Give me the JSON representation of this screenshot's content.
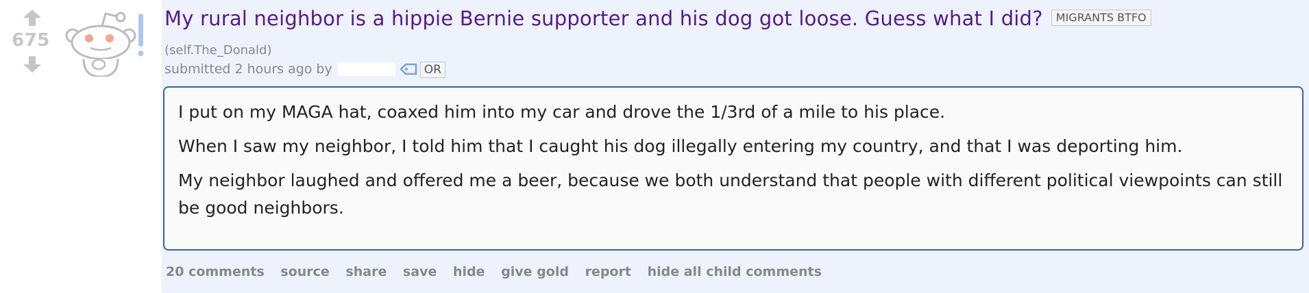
{
  "post": {
    "score": "675",
    "title": "My rural neighbor is a hippie Bernie supporter and his dog got loose. Guess what I did?",
    "link_flair": "MIGRANTS BTFO",
    "domain": "(self.The_Donald)",
    "tagline_prefix": "submitted 2 hours ago by",
    "author_flair": "OR",
    "selftext": [
      "I put on my MAGA hat, coaxed him into my car and drove the 1/3rd of a mile to his place.",
      "When I saw my neighbor, I told him that I caught his dog illegally entering my country, and that I was deporting him.",
      "My neighbor laughed and offered me a beer, because we both understand that people with different political viewpoints can still be good neighbors."
    ],
    "buttons": {
      "comments": "20 comments",
      "source": "source",
      "share": "share",
      "save": "save",
      "hide": "hide",
      "give_gold": "give gold",
      "report": "report",
      "hide_child": "hide all child comments"
    }
  },
  "colors": {
    "title": "#551a8b",
    "score": "#c6c6c6",
    "selftext_border": "#336699",
    "post_background": "#eef2fc",
    "muted": "#888888"
  },
  "icons": {
    "upvote": "upvote-arrow-icon",
    "downvote": "downvote-arrow-icon",
    "thumbnail": "reddit-alien-thumbnail-icon",
    "tag": "tag-icon"
  }
}
